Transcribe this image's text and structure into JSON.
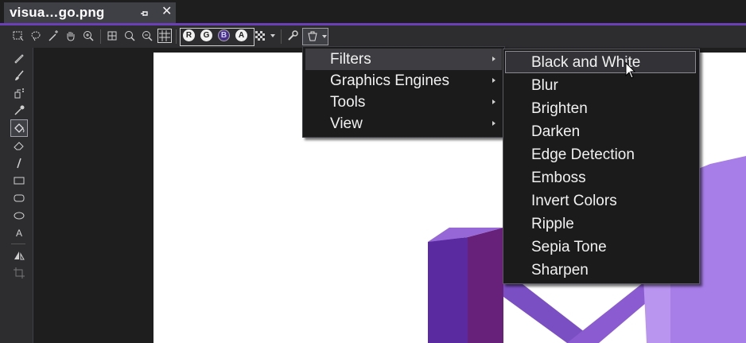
{
  "tab": {
    "title": "visua…go.png",
    "pin_icon": "pin-icon",
    "close_label": "✕"
  },
  "toolbar": {
    "channels": [
      "R",
      "G",
      "B",
      "A"
    ],
    "icons": [
      "select-rect-icon",
      "lasso-icon",
      "magic-wand-icon",
      "pan-hand-icon",
      "zoom-icon",
      "fit-icon",
      "zoom-in-icon",
      "zoom-out-icon",
      "grid-icon",
      "checker-icon",
      "wrench-icon",
      "advanced-icon"
    ]
  },
  "tools_rail": {
    "text_tool_label": "A"
  },
  "advanced_menu": {
    "items": [
      {
        "label": "Filters",
        "has_submenu": true,
        "highlighted": true
      },
      {
        "label": "Graphics Engines",
        "has_submenu": true
      },
      {
        "label": "Tools",
        "has_submenu": true
      },
      {
        "label": "View",
        "has_submenu": true
      }
    ]
  },
  "filters_menu": {
    "items": [
      {
        "label": "Black and White",
        "highlighted": true
      },
      {
        "label": "Blur"
      },
      {
        "label": "Brighten"
      },
      {
        "label": "Darken"
      },
      {
        "label": "Edge Detection"
      },
      {
        "label": "Emboss"
      },
      {
        "label": "Invert Colors"
      },
      {
        "label": "Ripple"
      },
      {
        "label": "Sepia Tone"
      },
      {
        "label": "Sharpen"
      }
    ]
  },
  "colors": {
    "accent": "#6a3fb8",
    "logo_dark": "#68217a",
    "logo_mid": "#7b4fc4",
    "logo_light": "#a77de8"
  }
}
